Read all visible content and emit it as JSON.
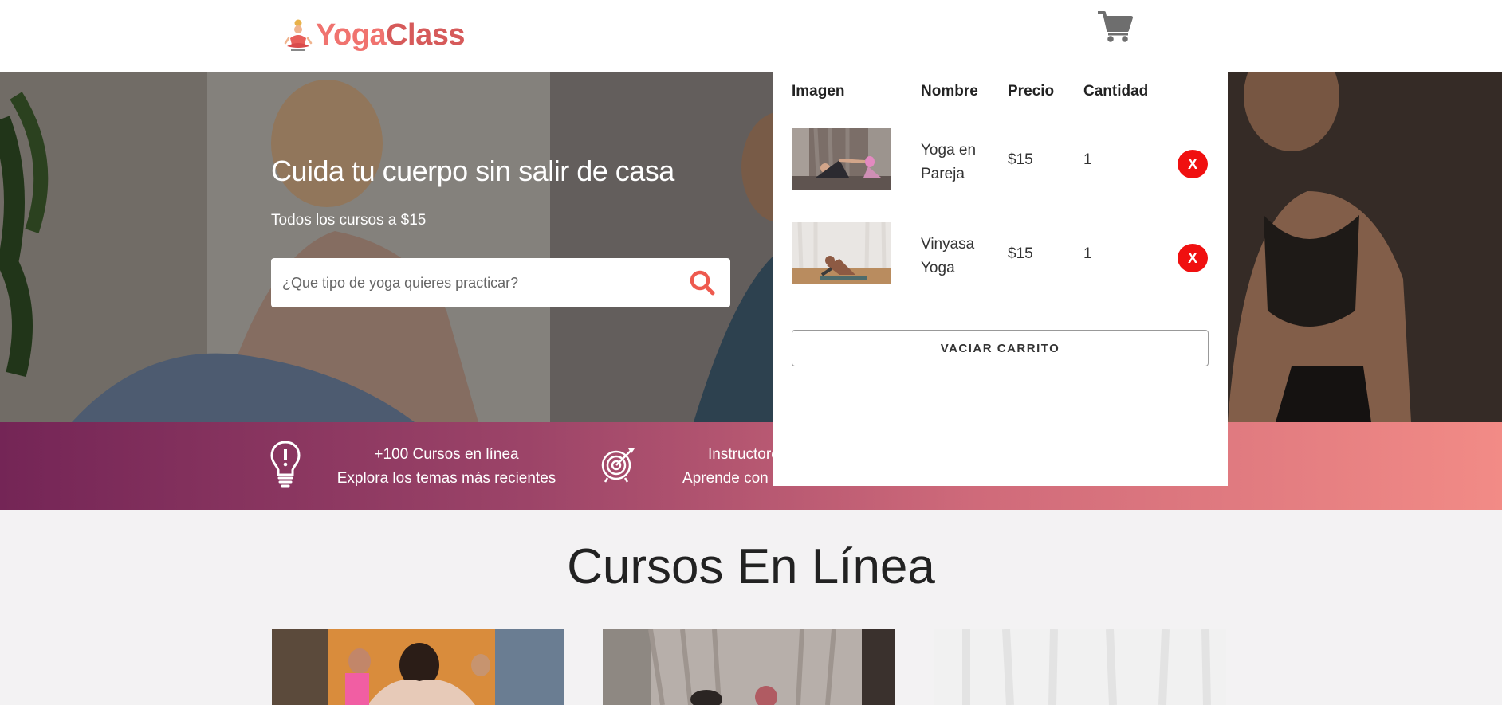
{
  "header": {
    "logo_part1": "Yoga",
    "logo_part2": "Class",
    "cart_icon": "shopping-cart-icon"
  },
  "hero": {
    "title": "Cuida tu cuerpo sin salir de casa",
    "subtitle": "Todos los cursos a $15",
    "search_placeholder": "¿Que tipo de yoga quieres practicar?",
    "search_icon": "search-icon"
  },
  "features": [
    {
      "icon": "lightbulb-icon",
      "line1": "+100 Cursos en línea",
      "line2": "Explora los temas más recientes"
    },
    {
      "icon": "target-icon",
      "line1": "Instructore",
      "line2": "Aprende con"
    }
  ],
  "courses": {
    "title": "Cursos En Línea"
  },
  "cart": {
    "headers": [
      "Imagen",
      "Nombre",
      "Precio",
      "Cantidad"
    ],
    "items": [
      {
        "name": "Yoga en Pareja",
        "price": "$15",
        "quantity": "1",
        "remove": "X"
      },
      {
        "name": "Vinyasa Yoga",
        "price": "$15",
        "quantity": "1",
        "remove": "X"
      }
    ],
    "empty_label": "VACIAR CARRITO"
  },
  "colors": {
    "logo_yoga": "#f0736f",
    "logo_class": "#d65a5a",
    "remove_button": "#f01010",
    "features_gradient_start": "#742556",
    "features_gradient_end": "#f28b86"
  }
}
